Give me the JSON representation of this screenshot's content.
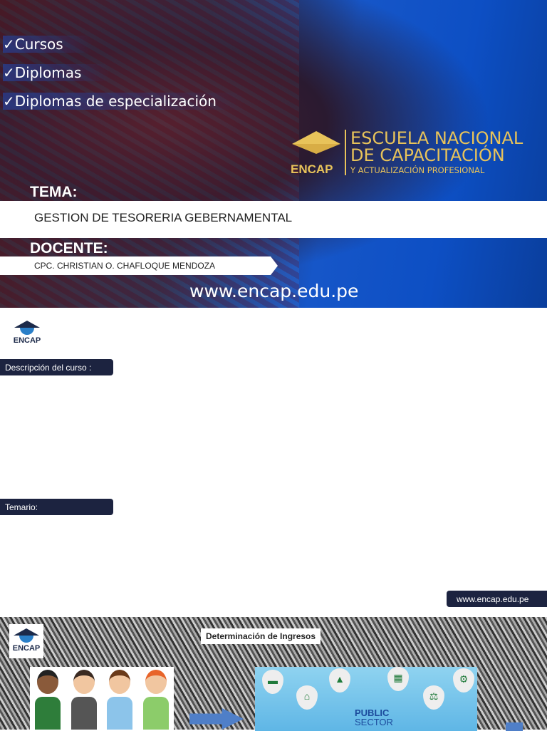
{
  "banner": {
    "checklist": [
      "Cursos",
      "Diplomas",
      "Diplomas de especialización"
    ],
    "check_glyph": "✓",
    "logo": {
      "short": "ENCAP",
      "line1": "ESCUELA NACIONAL",
      "line2": "DE CAPACITACIÓN",
      "line3": "Y ACTUALIZACIÓN PROFESIONAL"
    },
    "tema_label": "TEMA:",
    "tema": "GESTION DE TESORERIA GEBERNAMENTAL",
    "docente_label": "DOCENTE:",
    "docente": "CPC. CHRISTIAN O. CHAFLOQUE MENDOZA",
    "url": "www.encap.edu.pe"
  },
  "slide2": {
    "logo": "ENCAP",
    "description_label": "Descripción del curso :",
    "temario_label": "Temario:",
    "url": "www.encap.edu.pe"
  },
  "slide3": {
    "logo": "ENCAP",
    "title": "Determinación de Ingresos",
    "public_sector_line1": "PUBLIC",
    "public_sector_line2": "SECTOR"
  },
  "colors": {
    "navy": "#1c2340",
    "gold": "#e8c35a",
    "blue": "#0d4fc4"
  }
}
